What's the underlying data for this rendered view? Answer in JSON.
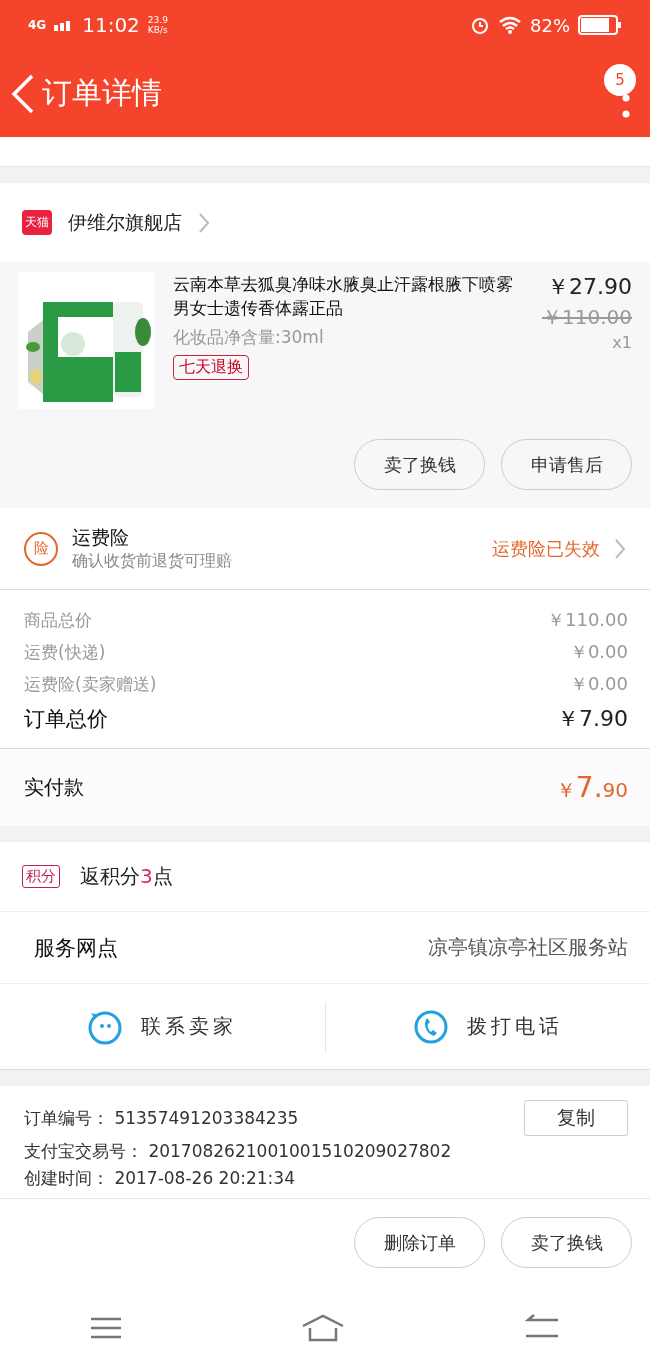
{
  "status_bar": {
    "network": "4G",
    "time": "11:02",
    "speed": "23.9",
    "speed_unit": "KB/s",
    "battery_text": "82%"
  },
  "header": {
    "title": "订单详情",
    "badge": "5"
  },
  "store": {
    "tag": "天猫",
    "name": "伊维尔旗舰店"
  },
  "product": {
    "title": "云南本草去狐臭净味水腋臭止汗露根腋下喷雾男女士遗传香体露正品",
    "spec": "化妆品净含量:30ml",
    "tag": "七天退换",
    "price": "￥27.90",
    "original_price": "￥110.00",
    "quantity": "x1",
    "buttons": [
      "卖了换钱",
      "申请售后"
    ]
  },
  "insurance": {
    "icon": "险",
    "title": "运费险",
    "subtitle": "确认收货前退货可理赔",
    "status": "运费险已失效"
  },
  "fees": [
    {
      "label": "商品总价",
      "value": "￥110.00",
      "kind": "minor"
    },
    {
      "label": "运费(快递)",
      "value": "￥0.00",
      "kind": "minor"
    },
    {
      "label": "运费险(卖家赠送)",
      "value": "￥0.00",
      "kind": "minor"
    },
    {
      "label": "订单总价",
      "value": "￥7.90",
      "kind": "total"
    }
  ],
  "paid": {
    "label": "实付款",
    "currency": "￥",
    "integer": "7.",
    "decimal": "90"
  },
  "points": {
    "tag": "积分",
    "before": "返积分",
    "count": "3",
    "after": "点"
  },
  "service": {
    "label": "服务网点",
    "value": "凉亭镇凉亭社区服务站"
  },
  "contact": [
    {
      "label": "联系卖家",
      "kind": "chat"
    },
    {
      "label": "拨打电话",
      "kind": "phone"
    }
  ],
  "order_info": [
    {
      "label": "订单编号：",
      "value": "51357491203384235"
    },
    {
      "label": "支付宝交易号：",
      "value": "2017082621001001510209027802"
    },
    {
      "label": "创建时间：",
      "value": "2017-08-26 20:21:34"
    }
  ],
  "copy_button": "复制",
  "bottom_buttons": [
    "删除订单",
    "卖了换钱"
  ]
}
